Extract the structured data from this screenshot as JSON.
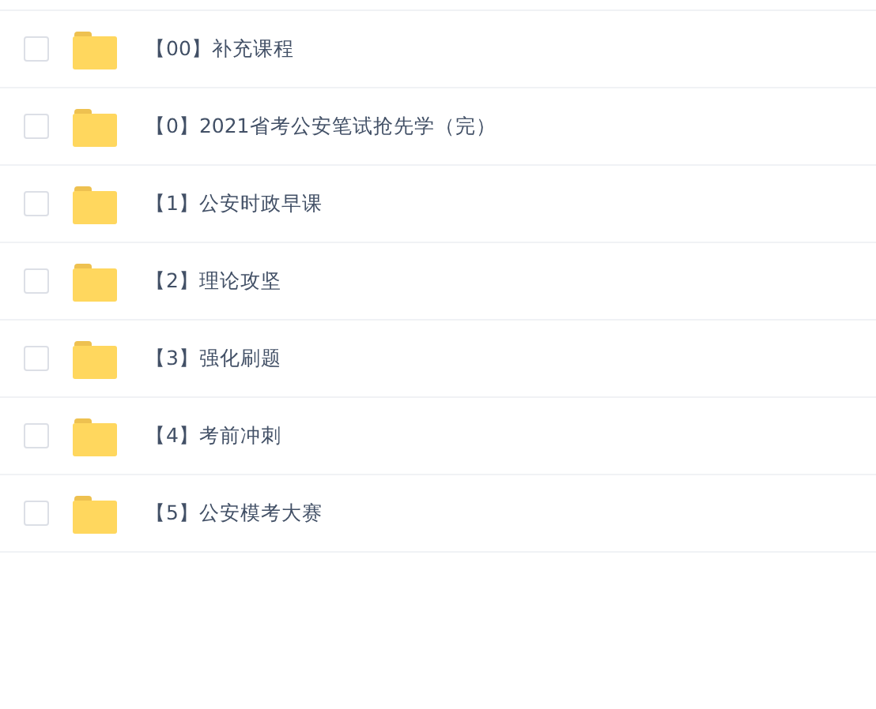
{
  "files": [
    {
      "name": "【00】补充课程",
      "checked": false
    },
    {
      "name": "【0】2021省考公安笔试抢先学（完）",
      "checked": false
    },
    {
      "name": "【1】公安时政早课",
      "checked": false
    },
    {
      "name": "【2】理论攻坚",
      "checked": false
    },
    {
      "name": "【3】强化刷题",
      "checked": false
    },
    {
      "name": "【4】考前冲刺",
      "checked": false
    },
    {
      "name": "【5】公安模考大赛",
      "checked": false
    }
  ]
}
